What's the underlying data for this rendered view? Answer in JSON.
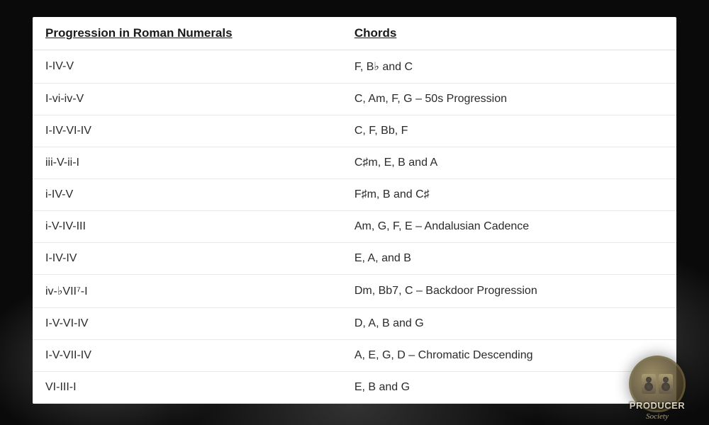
{
  "table": {
    "headers": {
      "progression": "Progression in Roman Numerals",
      "chords": "Chords"
    },
    "rows": [
      {
        "progression": "I-IV-V",
        "chords": "F, B♭ and C"
      },
      {
        "progression": "I-vi-iv-V",
        "chords": "C, Am, F, G – 50s Progression"
      },
      {
        "progression": "I-IV-VI-IV",
        "chords": "C, F, Bb, F"
      },
      {
        "progression": "iii-V-ii-I",
        "chords": "C♯m, E, B and A"
      },
      {
        "progression": "i-IV-V",
        "chords": "F♯m, B and C♯"
      },
      {
        "progression": "i-V-IV-III",
        "chords": "Am, G, F, E – Andalusian Cadence"
      },
      {
        "progression": "I-IV-IV",
        "chords": "E, A, and B"
      },
      {
        "progression": "iv-♭VII⁷-I",
        "chords": "Dm, Bb7, C – Backdoor Progression"
      },
      {
        "progression": "I-V-VI-IV",
        "chords": "D, A, B and G"
      },
      {
        "progression": "I-V-VII-IV",
        "chords": "A, E, G, D – Chromatic Descending"
      },
      {
        "progression": "VI-III-I",
        "chords": "E, B and G"
      }
    ]
  },
  "watermark": {
    "brand": "PRODUCER",
    "subbrand": "Society"
  }
}
